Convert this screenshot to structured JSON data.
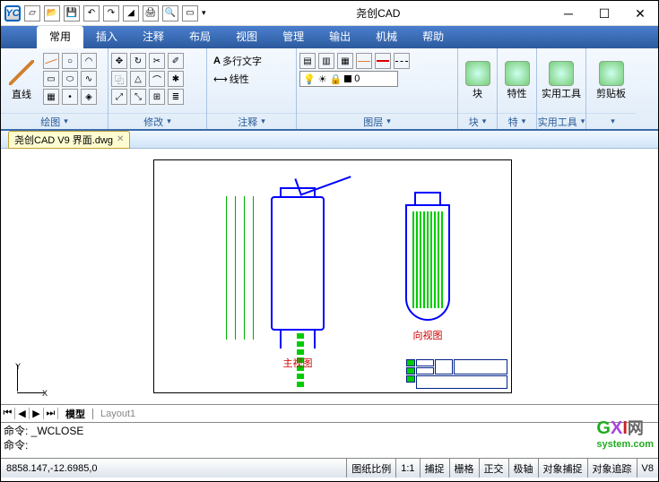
{
  "title": "尧创CAD",
  "menu_tabs": [
    "常用",
    "插入",
    "注释",
    "布局",
    "视图",
    "管理",
    "输出",
    "机械",
    "帮助"
  ],
  "ribbon": {
    "panel_line": {
      "label": "直线",
      "group": "绘图"
    },
    "panel_modify": {
      "group": "修改"
    },
    "panel_annotate": {
      "mtext": "多行文字",
      "linear": "线性",
      "group": "注释"
    },
    "panel_layer": {
      "zero": "0",
      "group": "图层"
    },
    "panel_block": {
      "label": "块",
      "group": "块"
    },
    "panel_prop": {
      "label": "特性",
      "group": "特"
    },
    "panel_util": {
      "label": "实用工具",
      "group": "实用工具"
    },
    "panel_clip": {
      "label": "剪贴板"
    }
  },
  "doc_tab": "尧创CAD V9 界面.dwg",
  "axes": {
    "y": "Y",
    "x": "X"
  },
  "tank1_label": "主视图",
  "tank2_label": "向视图",
  "model_tabs": {
    "model": "模型",
    "layout1": "Layout1"
  },
  "cmd1": "命令: _WCLOSE",
  "cmd2": "命令:",
  "status": {
    "coords": "8858.147,-12.6985,0",
    "scale_label": "图纸比例",
    "scale": "1:1",
    "snap": "捕捉",
    "grid": "栅格",
    "ortho": "正交",
    "polar": "极轴",
    "osnap": "对象捕捉",
    "otrack": "对象追踪",
    "ver": "V8"
  },
  "watermark": {
    "brand": "GXI",
    "suffix": "网",
    "url": "system.com"
  }
}
